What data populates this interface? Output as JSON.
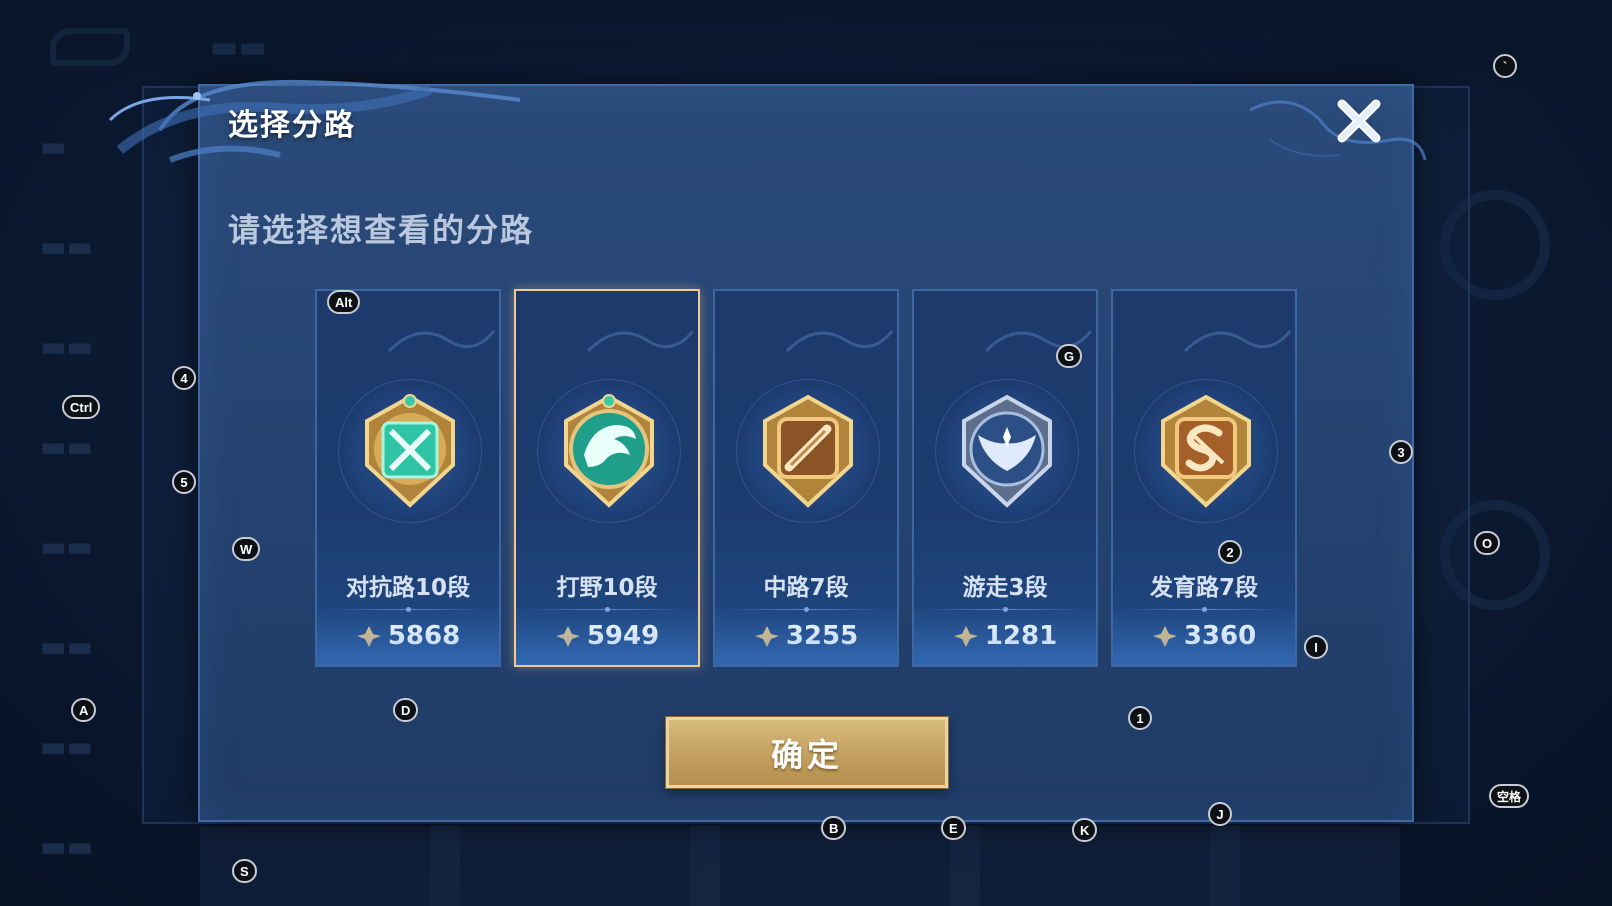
{
  "dialog": {
    "title": "选择分路",
    "subtitle": "请选择想查看的分路",
    "confirm_label": "确定",
    "close_icon": "close-icon"
  },
  "cards": [
    {
      "label": "对抗路10段",
      "score": "5868",
      "icon": "clash-lane-emblem-icon",
      "selected": false,
      "emblem_color": "#2fc4a4"
    },
    {
      "label": "打野10段",
      "score": "5949",
      "icon": "jungle-dragon-emblem-icon",
      "selected": true,
      "emblem_color": "#1f9e8a"
    },
    {
      "label": "中路7段",
      "score": "3255",
      "icon": "mid-lane-emblem-icon",
      "selected": false,
      "emblem_color": "#c48a46"
    },
    {
      "label": "游走3段",
      "score": "1281",
      "icon": "roam-wing-emblem-icon",
      "selected": false,
      "emblem_color": "#6f88b4"
    },
    {
      "label": "发育路7段",
      "score": "3360",
      "icon": "farm-lane-emblem-icon",
      "selected": false,
      "emblem_color": "#c9853c"
    }
  ],
  "key_hints": [
    "Alt",
    "Ctrl",
    "4",
    "5",
    "W",
    "A",
    "D",
    "S",
    "G",
    "2",
    "3",
    "I",
    "O",
    "1",
    "J",
    "K",
    "E",
    "B",
    "`",
    "空格"
  ],
  "colors": {
    "dialog_bg": "#264574",
    "selected_border": "#f1c88f",
    "confirm_gold": "#c6a465",
    "card_border": "#3d67a2"
  }
}
